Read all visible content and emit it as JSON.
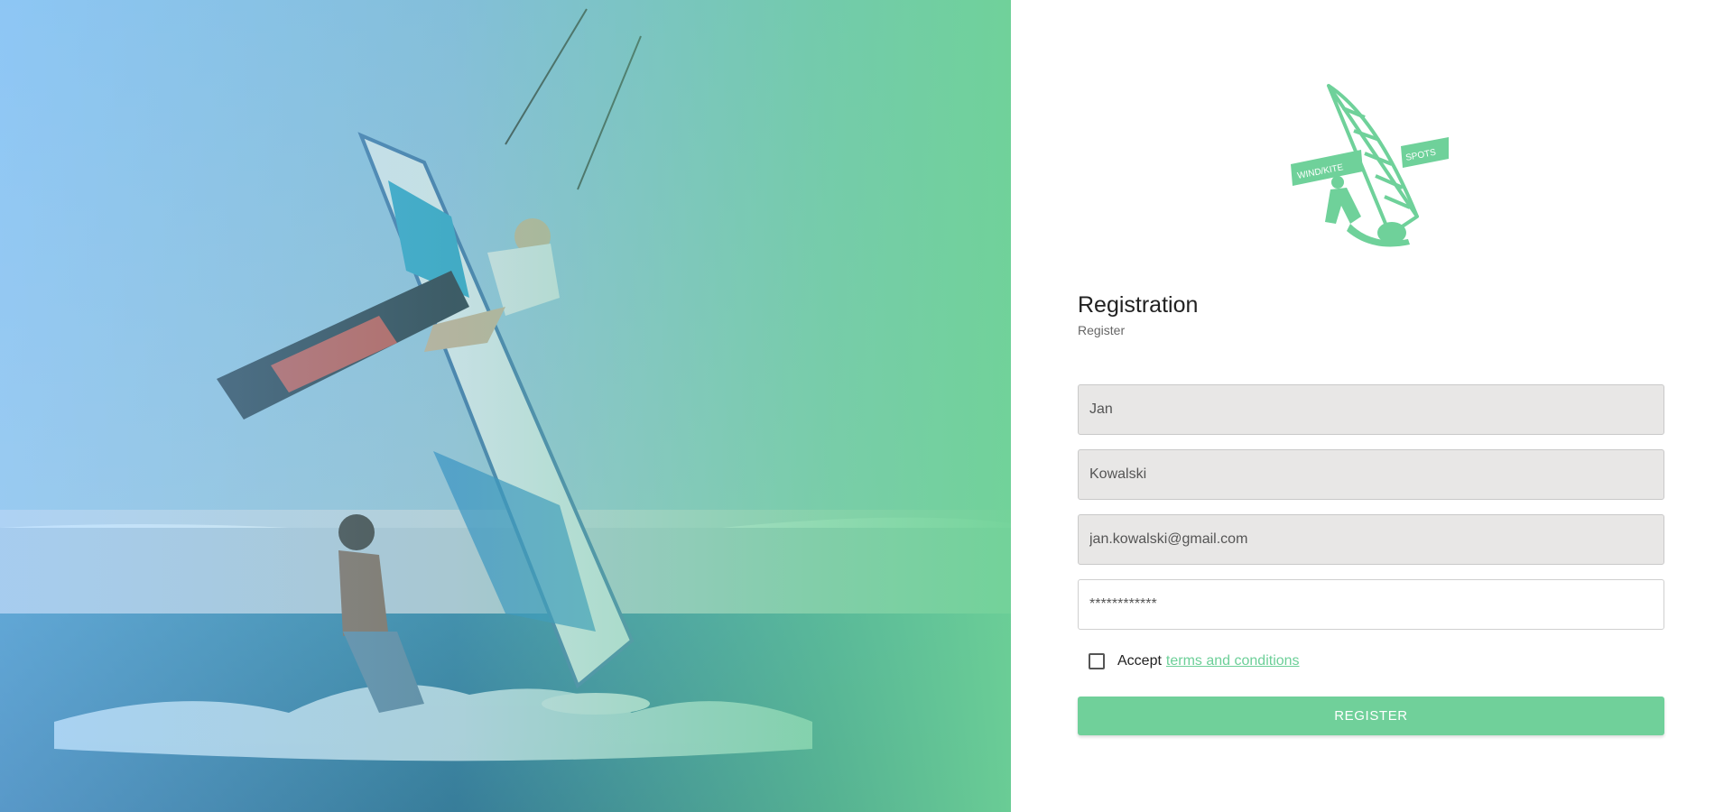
{
  "brand": {
    "logo_text_left": "WIND/KITE",
    "logo_text_right": "SPOTS",
    "accent_color": "#70d09a"
  },
  "form": {
    "title": "Registration",
    "subtitle": "Register",
    "first_name_value": "Jan",
    "last_name_value": "Kowalski",
    "email_value": "jan.kowalski@gmail.com",
    "password_value": "************",
    "terms_prefix": "Accept",
    "terms_link": "terms and conditions",
    "terms_checked": false,
    "submit_label": "REGISTER"
  },
  "hero": {
    "image_subject": "kitesurfer and windsurfer on the sea"
  }
}
